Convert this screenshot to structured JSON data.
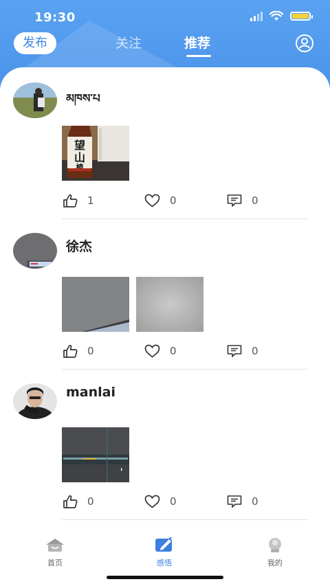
{
  "status_bar": {
    "time": "19:30"
  },
  "header": {
    "publish_label": "发布",
    "tabs": [
      {
        "label": "关注",
        "active": false
      },
      {
        "label": "推荐",
        "active": true
      }
    ]
  },
  "posts": [
    {
      "author": "མཁས་པ",
      "likes": "1",
      "favorites": "0",
      "comments": "0"
    },
    {
      "author": "徐杰",
      "likes": "0",
      "favorites": "0",
      "comments": "0"
    },
    {
      "author": "manlai",
      "likes": "0",
      "favorites": "0",
      "comments": "0"
    }
  ],
  "bottom_nav": {
    "items": [
      {
        "label": "首页",
        "icon": "home-icon",
        "active": false
      },
      {
        "label": "感悟",
        "icon": "edit-icon",
        "active": true
      },
      {
        "label": "我的",
        "icon": "profile-icon",
        "active": false
      }
    ]
  },
  "colors": {
    "accent": "#3d7fe0",
    "header": "#4f97ec",
    "battery": "#f5d23a"
  }
}
